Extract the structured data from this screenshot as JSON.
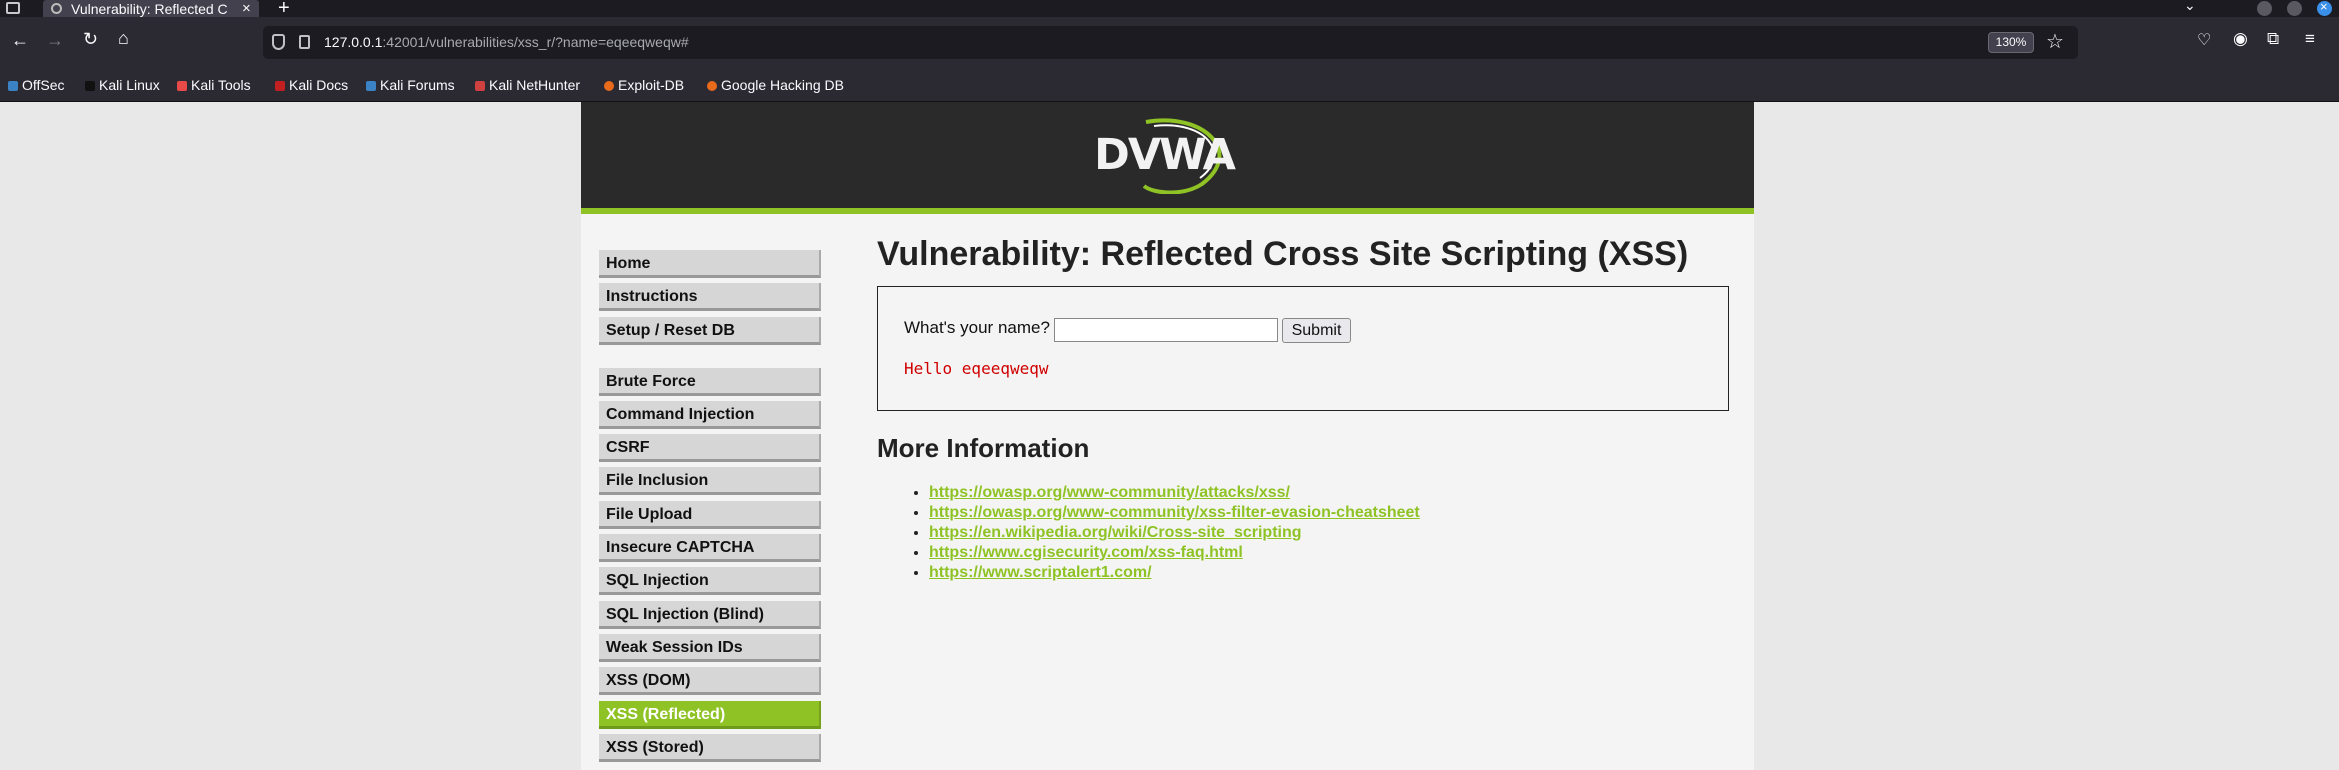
{
  "browser": {
    "tab_title": "Vulnerability: Reflected C",
    "tab_close": "×",
    "new_tab": "+",
    "list_all_tabs": "⌄",
    "url_host": "127.0.0.1",
    "url_rest": ":42001/vulnerabilities/xss_r/?name=eqeeqweqw#",
    "zoom": "130%",
    "bookmarks": [
      {
        "label": "OffSec",
        "color": "#3b82c4"
      },
      {
        "label": "Kali Linux",
        "color": "#111111"
      },
      {
        "label": "Kali Tools",
        "color": "#e84a4a"
      },
      {
        "label": "Kali Docs",
        "color": "#c22020"
      },
      {
        "label": "Kali Forums",
        "color": "#3b82c4"
      },
      {
        "label": "Kali NetHunter",
        "color": "#d04040"
      },
      {
        "label": "Exploit-DB",
        "color": "#e86a1a"
      },
      {
        "label": "Google Hacking DB",
        "color": "#e86a1a"
      }
    ]
  },
  "dvwa": {
    "logo": "DVWA",
    "accent_color": "#8fc325",
    "menu": {
      "group1": [
        "Home",
        "Instructions",
        "Setup / Reset DB"
      ],
      "group2": [
        "Brute Force",
        "Command Injection",
        "CSRF",
        "File Inclusion",
        "File Upload",
        "Insecure CAPTCHA",
        "SQL Injection",
        "SQL Injection (Blind)",
        "Weak Session IDs",
        "XSS (DOM)",
        "XSS (Reflected)",
        "XSS (Stored)"
      ],
      "selected": "XSS (Reflected)"
    },
    "title": "Vulnerability: Reflected Cross Site Scripting (XSS)",
    "form": {
      "label": "What's your name?",
      "input_value": "",
      "submit_label": "Submit",
      "output": "Hello eqeeqweqw"
    },
    "more_info": {
      "title": "More Information",
      "links": [
        "https://owasp.org/www-community/attacks/xss/",
        "https://owasp.org/www-community/xss-filter-evasion-cheatsheet",
        "https://en.wikipedia.org/wiki/Cross-site_scripting",
        "https://www.cgisecurity.com/xss-faq.html",
        "https://www.scriptalert1.com/"
      ]
    }
  }
}
